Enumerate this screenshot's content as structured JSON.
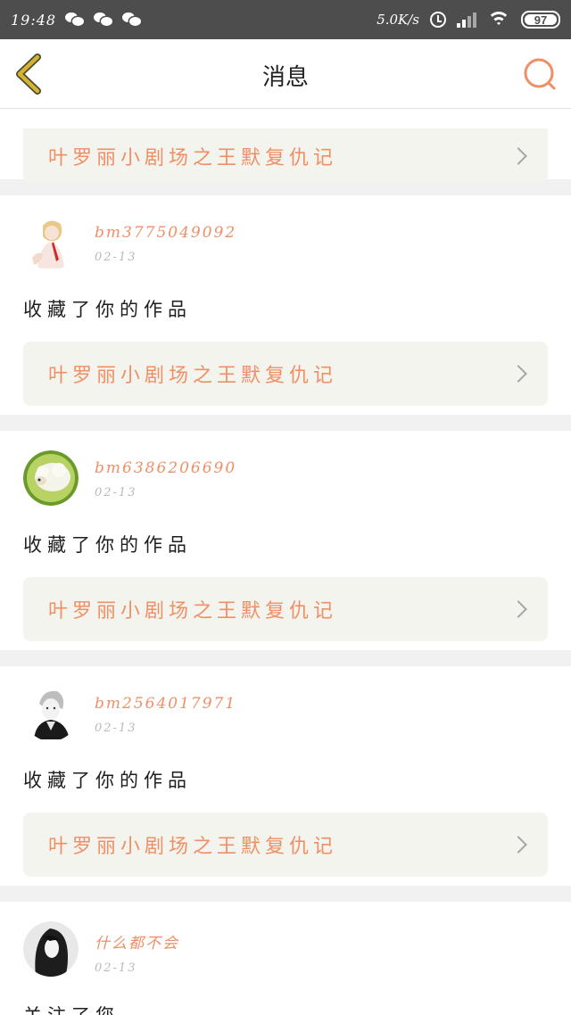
{
  "status_bar": {
    "time": "19:48",
    "net_speed": "5.0K/s",
    "battery": "97",
    "left_icons": [
      "wechat-icon",
      "wechat-icon",
      "wechat-icon"
    ],
    "right_icons": [
      "alarm-icon",
      "signal-icon",
      "wifi-icon",
      "battery-icon"
    ]
  },
  "header": {
    "title": "消息",
    "back_icon": "chevron-left-icon",
    "search_icon": "search-icon",
    "accent_color": "#ef8f66",
    "back_color": "#d6b233"
  },
  "feed": {
    "top_partial": {
      "work_title": "叶罗丽小剧场之王默复仇记"
    },
    "items": [
      {
        "username": "bm3775049092",
        "date": "02-13",
        "action": "收藏了你的作品",
        "work_title": "叶罗丽小剧场之王默复仇记"
      },
      {
        "username": "bm6386206690",
        "date": "02-13",
        "action": "收藏了你的作品",
        "work_title": "叶罗丽小剧场之王默复仇记"
      },
      {
        "username": "bm2564017971",
        "date": "02-13",
        "action": "收藏了你的作品",
        "work_title": "叶罗丽小剧场之王默复仇记"
      },
      {
        "username": "什么都不会",
        "date": "02-13",
        "action": "关注了您"
      }
    ]
  }
}
